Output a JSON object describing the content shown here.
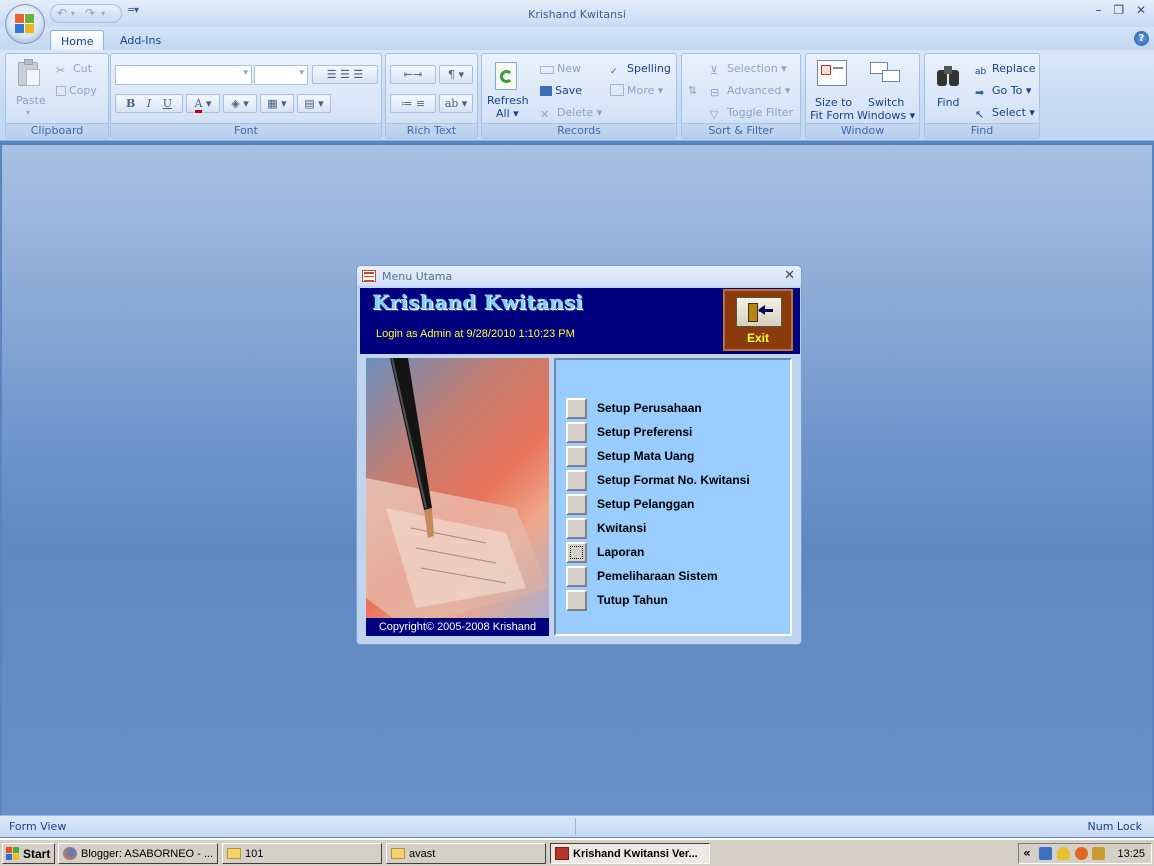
{
  "window": {
    "title": "Krishand Kwitansi",
    "minimize": "–",
    "restore": "❐",
    "close": "✕"
  },
  "tabs": [
    {
      "label": "Home",
      "active": true
    },
    {
      "label": "Add-Ins",
      "active": false
    }
  ],
  "ribbon": {
    "clipboard": {
      "label": "Clipboard",
      "paste": "Paste",
      "cut": "Cut",
      "copy": "Copy"
    },
    "font": {
      "label": "Font",
      "bold": "B",
      "italic": "I",
      "underline": "U",
      "font_color": "A"
    },
    "rich_text": {
      "label": "Rich Text"
    },
    "records": {
      "label": "Records",
      "refresh": "Refresh",
      "refresh_sub": "All",
      "new": "New",
      "save": "Save",
      "delete": "Delete",
      "spelling": "Spelling",
      "more": "More"
    },
    "sort_filter": {
      "label": "Sort & Filter",
      "selection": "Selection",
      "advanced": "Advanced",
      "toggle_filter": "Toggle Filter"
    },
    "window": {
      "label": "Window",
      "size_to_fit_1": "Size to",
      "size_to_fit_2": "Fit Form",
      "switch_1": "Switch",
      "switch_2": "Windows"
    },
    "find": {
      "label": "Find",
      "find": "Find",
      "replace": "Replace",
      "goto": "Go To",
      "select": "Select"
    }
  },
  "form": {
    "title": "Menu Utama",
    "app_title": "Krishand Kwitansi",
    "login_text": "Login as Admin at 9/28/2010 1:10:23 PM",
    "exit_label": "Exit",
    "copyright": "Copyright© 2005-2008 Krishand",
    "menu_items": [
      "Setup Perusahaan",
      "Setup Preferensi",
      "Setup Mata Uang",
      "Setup Format No. Kwitansi",
      "Setup Pelanggan",
      "Kwitansi",
      "Laporan",
      "Pemeliharaan Sistem",
      "Tutup Tahun"
    ]
  },
  "status": {
    "view": "Form View",
    "num_lock": "Num Lock"
  },
  "taskbar": {
    "start": "Start",
    "tasks": [
      "Blogger: ASABORNEO - ...",
      "101",
      "avast",
      "Krishand Kwitansi Ver..."
    ],
    "clock": "13:25"
  },
  "colors": {
    "form_header": "#00007f",
    "menu_panel": "#99ccff",
    "exit_button": "#8b3a0c",
    "login_text": "#ffff33"
  }
}
